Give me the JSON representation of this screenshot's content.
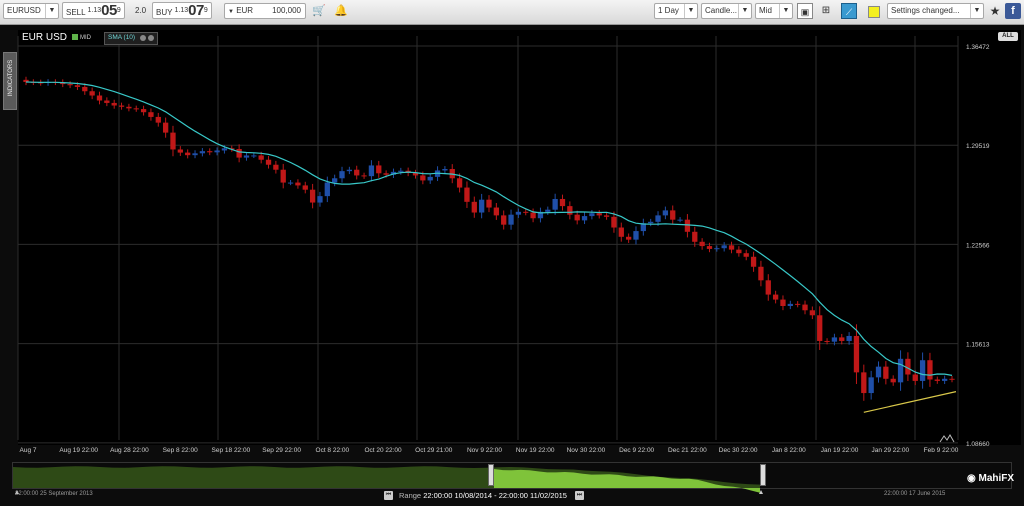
{
  "toolbar": {
    "symbol": "EURUSD",
    "sell_label": "SELL",
    "sell_prefix": "1.13",
    "sell_big": "05",
    "sell_pip": "9",
    "spread": "2.0",
    "buy_label": "BUY",
    "buy_prefix": "1.13",
    "buy_big": "07",
    "buy_pip": "9",
    "currency": "EUR",
    "amount": "100,000",
    "timeframe": "1 Day",
    "chart_type": "Candle...",
    "price_type": "Mid",
    "settings": "Settings changed...",
    "highlight_color": "#f4f020"
  },
  "chart_header": {
    "symbol_title": "EUR USD",
    "price_mode": "MID",
    "indicator": "SMA (10)",
    "all_button": "ALL",
    "indicators_tab": "INDICATORS"
  },
  "chart_data": {
    "type": "candlestick",
    "instrument": "EUR USD",
    "ylim": [
      1.0886,
      1.3647
    ],
    "y_ticks": [
      "1.36472",
      "1.29519",
      "1.22566",
      "1.15613",
      "1.08660"
    ],
    "x_tick_labels": [
      "Aug 7",
      "Aug 19 22:00",
      "Aug 28 22:00",
      "Sep 8 22:00",
      "Sep 18 22:00",
      "Sep 29 22:00",
      "Oct 8 22:00",
      "Oct 20 22:00",
      "Oct 29 21:00",
      "Nov 9 22:00",
      "Nov 19 22:00",
      "Nov 30 22:00",
      "Dec 9 22:00",
      "Dec 21 22:00",
      "Dec 30 22:00",
      "Jan 8 22:00",
      "Jan 19 22:00",
      "Jan 29 22:00",
      "Feb 9 22:00"
    ],
    "grid": true,
    "colors": {
      "up": "#1f4fa8",
      "down": "#c01818",
      "sma": "#38c8c8",
      "trendline": "#d9c84a"
    },
    "close": [
      1.3395,
      1.3392,
      1.3388,
      1.3395,
      1.3392,
      1.338,
      1.3372,
      1.336,
      1.333,
      1.33,
      1.3265,
      1.3248,
      1.323,
      1.3221,
      1.321,
      1.3205,
      1.3183,
      1.315,
      1.311,
      1.304,
      1.2922,
      1.29,
      1.2882,
      1.2895,
      1.291,
      1.2902,
      1.2915,
      1.293,
      1.2925,
      1.2865,
      1.288,
      1.288,
      1.285,
      1.2815,
      1.278,
      1.269,
      1.269,
      1.267,
      1.264,
      1.255,
      1.2595,
      1.269,
      1.272,
      1.277,
      1.278,
      1.274,
      1.2735,
      1.281,
      1.2755,
      1.2745,
      1.2765,
      1.2773,
      1.2757,
      1.274,
      1.2705,
      1.273,
      1.2775,
      1.2785,
      1.272,
      1.2655,
      1.2555,
      1.248,
      1.257,
      1.2515,
      1.246,
      1.2395,
      1.2465,
      1.2485,
      1.248,
      1.244,
      1.2485,
      1.25,
      1.2575,
      1.2525,
      1.2465,
      1.2425,
      1.2455,
      1.2475,
      1.246,
      1.245,
      1.2375,
      1.231,
      1.229,
      1.235,
      1.2405,
      1.2415,
      1.246,
      1.2495,
      1.243,
      1.243,
      1.2345,
      1.2275,
      1.2245,
      1.2225,
      1.223,
      1.225,
      1.222,
      1.2195,
      1.217,
      1.21,
      1.2005,
      1.1905,
      1.187,
      1.1825,
      1.184,
      1.1835,
      1.1795,
      1.176,
      1.158,
      1.1575,
      1.1605,
      1.158,
      1.1615,
      1.136,
      1.1215,
      1.1325,
      1.14,
      1.1315,
      1.129,
      1.1455,
      1.1345,
      1.13,
      1.1445,
      1.131,
      1.13,
      1.1315,
      1.131
    ],
    "sma_period": 10,
    "trendline": {
      "from_index": 114,
      "from_price": 1.108,
      "to_index": 126,
      "to_price": 1.1225
    },
    "range": {
      "label": "Range",
      "start": "22:00:00 10/08/2014",
      "separator": "-",
      "end": "22:00:00 11/02/2015"
    },
    "navigator": {
      "left_label": "22:00:00 25 September 2013",
      "right_label": "22:00:00 17 June 2015"
    }
  },
  "logo": "MahiFX"
}
